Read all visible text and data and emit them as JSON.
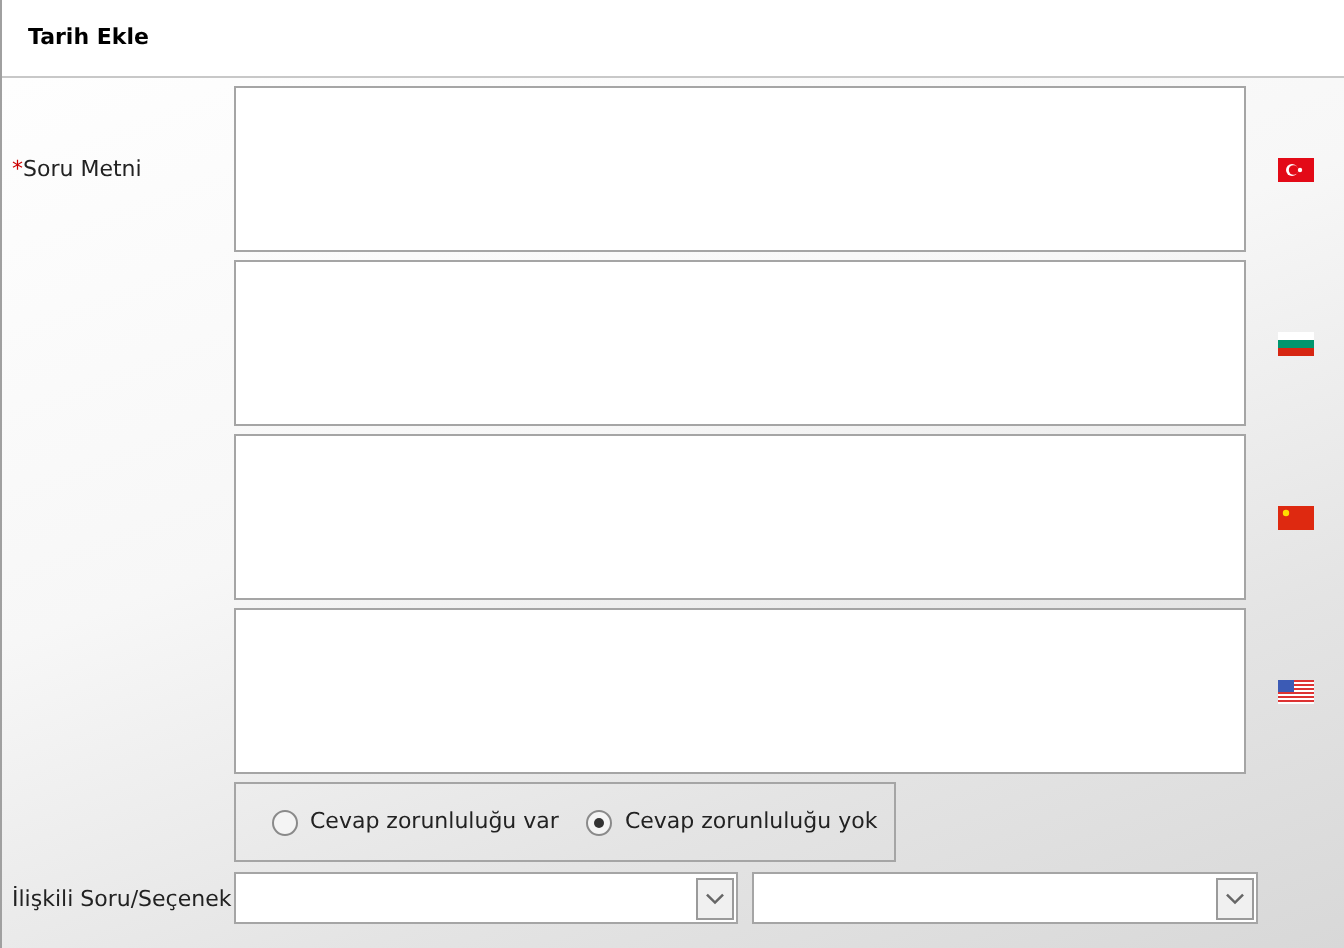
{
  "header": {
    "title": "Tarih Ekle"
  },
  "question": {
    "label": "Soru Metni",
    "required_mark": "*",
    "fields": [
      {
        "kind": "tr"
      },
      {
        "kind": "bg"
      },
      {
        "kind": "cn"
      },
      {
        "kind": "us"
      }
    ]
  },
  "answer_required": [
    {
      "label": "Cevap zorunluluğu var",
      "selected": false
    },
    {
      "label": "Cevap zorunluluğu yok",
      "selected": true
    }
  ],
  "related": {
    "label": "İlişkili Soru/Seçenek",
    "selects": [
      {
        "kind": "dropdown"
      },
      {
        "kind": "dropdown"
      }
    ]
  }
}
